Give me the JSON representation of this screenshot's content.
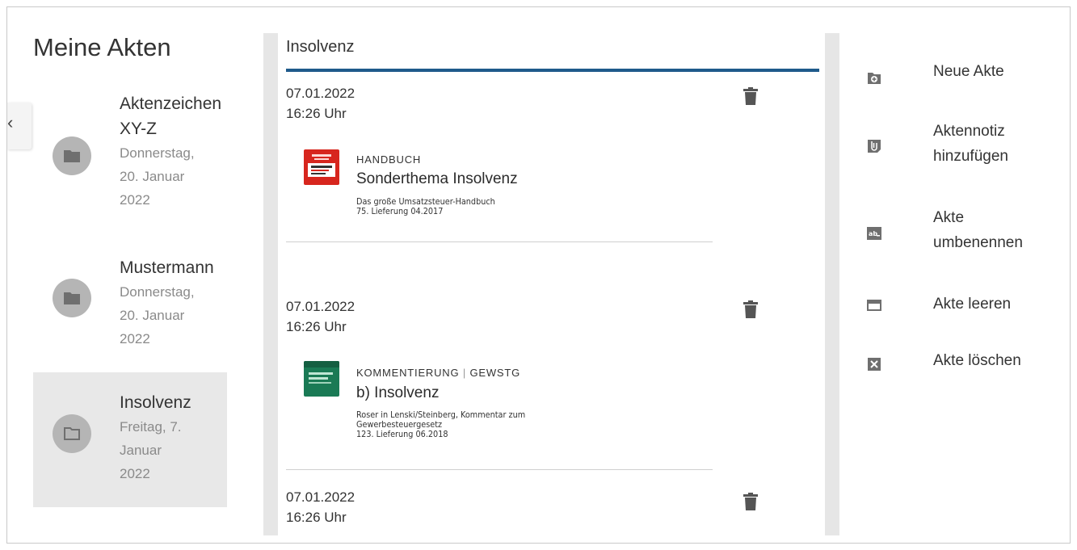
{
  "sidebar": {
    "title": "Meine Akten",
    "collapse_glyph": "‹",
    "files": [
      {
        "name_lines": [
          "Aktenzeichen",
          "XY-Z"
        ],
        "date_lines": [
          "Donnerstag,",
          "20. Januar",
          "2022"
        ],
        "icon": "folder-filled-icon",
        "active": false
      },
      {
        "name_lines": [
          "Mustermann"
        ],
        "date_lines": [
          "Donnerstag,",
          "20. Januar",
          "2022"
        ],
        "icon": "folder-filled-icon",
        "active": false
      },
      {
        "name_lines": [
          "Insolvenz"
        ],
        "date_lines": [
          "Freitag, 7.",
          "Januar",
          "2022"
        ],
        "icon": "folder-open-icon",
        "active": true
      }
    ]
  },
  "main": {
    "title": "Insolvenz",
    "entries": [
      {
        "date": "07.01.2022",
        "time": "16:26 Uhr",
        "type": "HANDBUCH",
        "type_extra": "",
        "title": "Sonderthema Insolvenz",
        "source_lines": [
          "Das große Umsatzsteuer-Handbuch",
          "75. Lieferung 04.2017"
        ]
      },
      {
        "date": "07.01.2022",
        "time": "16:26 Uhr",
        "type": "KOMMENTIERUNG",
        "type_sep": "|",
        "type_extra": "GEWSTG",
        "title": "b) Insolvenz",
        "source_lines": [
          "Roser in Lenski/Steinberg, Kommentar zum",
          "Gewerbesteuergesetz",
          "123. Lieferung 06.2018"
        ]
      },
      {
        "date": "07.01.2022",
        "time": "16:26 Uhr"
      }
    ]
  },
  "actions": [
    {
      "label_lines": [
        "Neue Akte"
      ],
      "icon": "new-file-icon"
    },
    {
      "label_lines": [
        "Aktennotiz",
        "hinzufügen"
      ],
      "icon": "paperclip-note-icon"
    },
    {
      "label_lines": [
        "Akte",
        "umbenennen"
      ],
      "icon": "rename-icon"
    },
    {
      "label_lines": [
        "Akte leeren"
      ],
      "icon": "empty-folder-icon"
    },
    {
      "label_lines": [
        "Akte löschen"
      ],
      "icon": "delete-box-icon"
    }
  ],
  "colors": {
    "accent": "#1f5a8b",
    "icon_gray": "#6f6f6f",
    "circle_gray": "#b5b5b5",
    "active_bg": "#e8e8e8"
  }
}
